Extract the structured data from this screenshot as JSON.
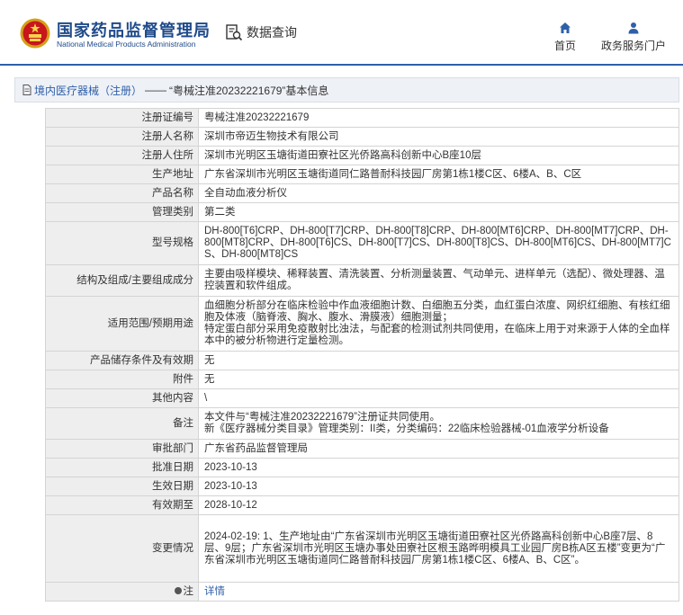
{
  "header": {
    "logo_cn": "国家药品监督管理局",
    "logo_en": "National Medical Products Administration",
    "query_label": "数据查询",
    "nav": {
      "home": "首页",
      "portal": "政务服务门户"
    }
  },
  "breadcrumb": {
    "category": "境内医疗器械（注册）",
    "separator": "——",
    "title": "“粤械注准20232221679”基本信息"
  },
  "table": {
    "rows": [
      {
        "key": "注册证编号",
        "value": "粤械注准20232221679"
      },
      {
        "key": "注册人名称",
        "value": "深圳市帝迈生物技术有限公司"
      },
      {
        "key": "注册人住所",
        "value": "深圳市光明区玉塘街道田寮社区光侨路高科创新中心B座10层"
      },
      {
        "key": "生产地址",
        "value": "广东省深圳市光明区玉塘街道同仁路普耐科技园厂房第1栋1楼C区、6楼A、B、C区"
      },
      {
        "key": "产品名称",
        "value": "全自动血液分析仪"
      },
      {
        "key": "管理类别",
        "value": "第二类"
      },
      {
        "key": "型号规格",
        "value": "DH-800[T6]CRP、DH-800[T7]CRP、DH-800[T8]CRP、DH-800[MT6]CRP、DH-800[MT7]CRP、DH-800[MT8]CRP、DH-800[T6]CS、DH-800[T7]CS、DH-800[T8]CS、DH-800[MT6]CS、DH-800[MT7]CS、DH-800[MT8]CS"
      },
      {
        "key": "结构及组成/主要组成成分",
        "value": "主要由吸样模块、稀释装置、清洗装置、分析测量装置、气动单元、进样单元（选配）、微处理器、温控装置和软件组成。"
      },
      {
        "key": "适用范围/预期用途",
        "value_lines": [
          "血细胞分析部分在临床检验中作血液细胞计数、白细胞五分类，血红蛋白浓度、网织红细胞、有核红细胞及体液（脑脊液、胸水、腹水、滑膜液）细胞测量；",
          "特定蛋白部分采用免疫散射比浊法，与配套的检测试剂共同使用，在临床上用于对来源于人体的全血样本中的被分析物进行定量检测。"
        ]
      },
      {
        "key": "产品储存条件及有效期",
        "value": "无"
      },
      {
        "key": "附件",
        "value": "无"
      },
      {
        "key": "其他内容",
        "value": "\\"
      },
      {
        "key": "备注",
        "value_lines": [
          "本文件与“粤械注准20232221679”注册证共同使用。",
          "新《医疗器械分类目录》管理类别：II类，分类编码：22临床检验器械-01血液学分析设备"
        ]
      },
      {
        "key": "审批部门",
        "value": "广东省药品监督管理局"
      },
      {
        "key": "批准日期",
        "value": "2023-10-13"
      },
      {
        "key": "生效日期",
        "value": "2023-10-13"
      },
      {
        "key": "有效期至",
        "value": "2028-10-12"
      },
      {
        "key": "变更情况",
        "value": "2024-02-19: 1、生产地址由“广东省深圳市光明区玉塘街道田寮社区光侨路高科创新中心B座7层、8层、9层；广东省深圳市光明区玉塘办事处田寮社区根玉路晔明模具工业园厂房B栋A区五楼”变更为“广东省深圳市光明区玉塘街道同仁路普耐科技园厂房第1栋1楼C区、6楼A、B、C区”。"
      },
      {
        "key": "注",
        "value": "详情"
      }
    ]
  }
}
